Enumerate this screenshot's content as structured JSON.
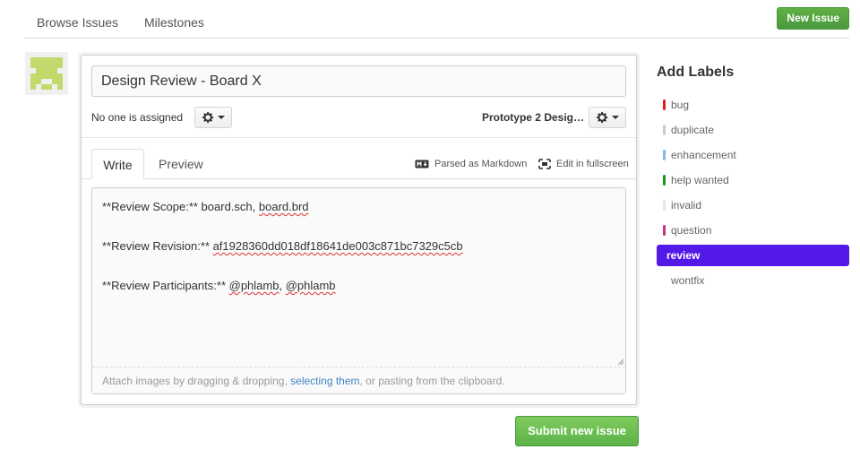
{
  "nav": {
    "browse": "Browse Issues",
    "milestones": "Milestones",
    "new_issue": "New Issue"
  },
  "form": {
    "title_value": "Design Review - Board X",
    "assignee_text": "No one is assigned",
    "milestone_text": "Prototype 2 Desig…",
    "tabs": {
      "write": "Write",
      "preview": "Preview"
    },
    "tools": {
      "markdown": "Parsed as Markdown",
      "fullscreen": "Edit in fullscreen"
    },
    "body": {
      "l1a": "**Review Scope:** board.sch, ",
      "l1b": "board.brd",
      "l2a": "**Review Revision:** ",
      "l2b": "af1928360dd018df18641de003c871bc7329c5cb",
      "l3a": "**Review Participants:** ",
      "l3b": "@phlamb",
      "l3c": ", ",
      "l3d": "@phlamb"
    },
    "attach": {
      "before": "Attach images by dragging & dropping, ",
      "link": "selecting them",
      "after": ", or pasting from the clipboard."
    },
    "submit": "Submit new issue"
  },
  "labels": {
    "title": "Add Labels",
    "items": [
      {
        "name": "bug",
        "color": "#e11d21"
      },
      {
        "name": "duplicate",
        "color": "#cccccc"
      },
      {
        "name": "enhancement",
        "color": "#84b6eb"
      },
      {
        "name": "help wanted",
        "color": "#159818"
      },
      {
        "name": "invalid",
        "color": "#e6e6e6"
      },
      {
        "name": "question",
        "color": "#cc317c"
      },
      {
        "name": "review",
        "color": "#5319e7",
        "selected": true
      },
      {
        "name": "wontfix",
        "color": "#ffffff"
      }
    ]
  },
  "icons": {
    "avatar": "identicon-avatar",
    "gear": "gear-icon",
    "markdown": "markdown-icon",
    "fullscreen": "fullscreen-icon"
  }
}
